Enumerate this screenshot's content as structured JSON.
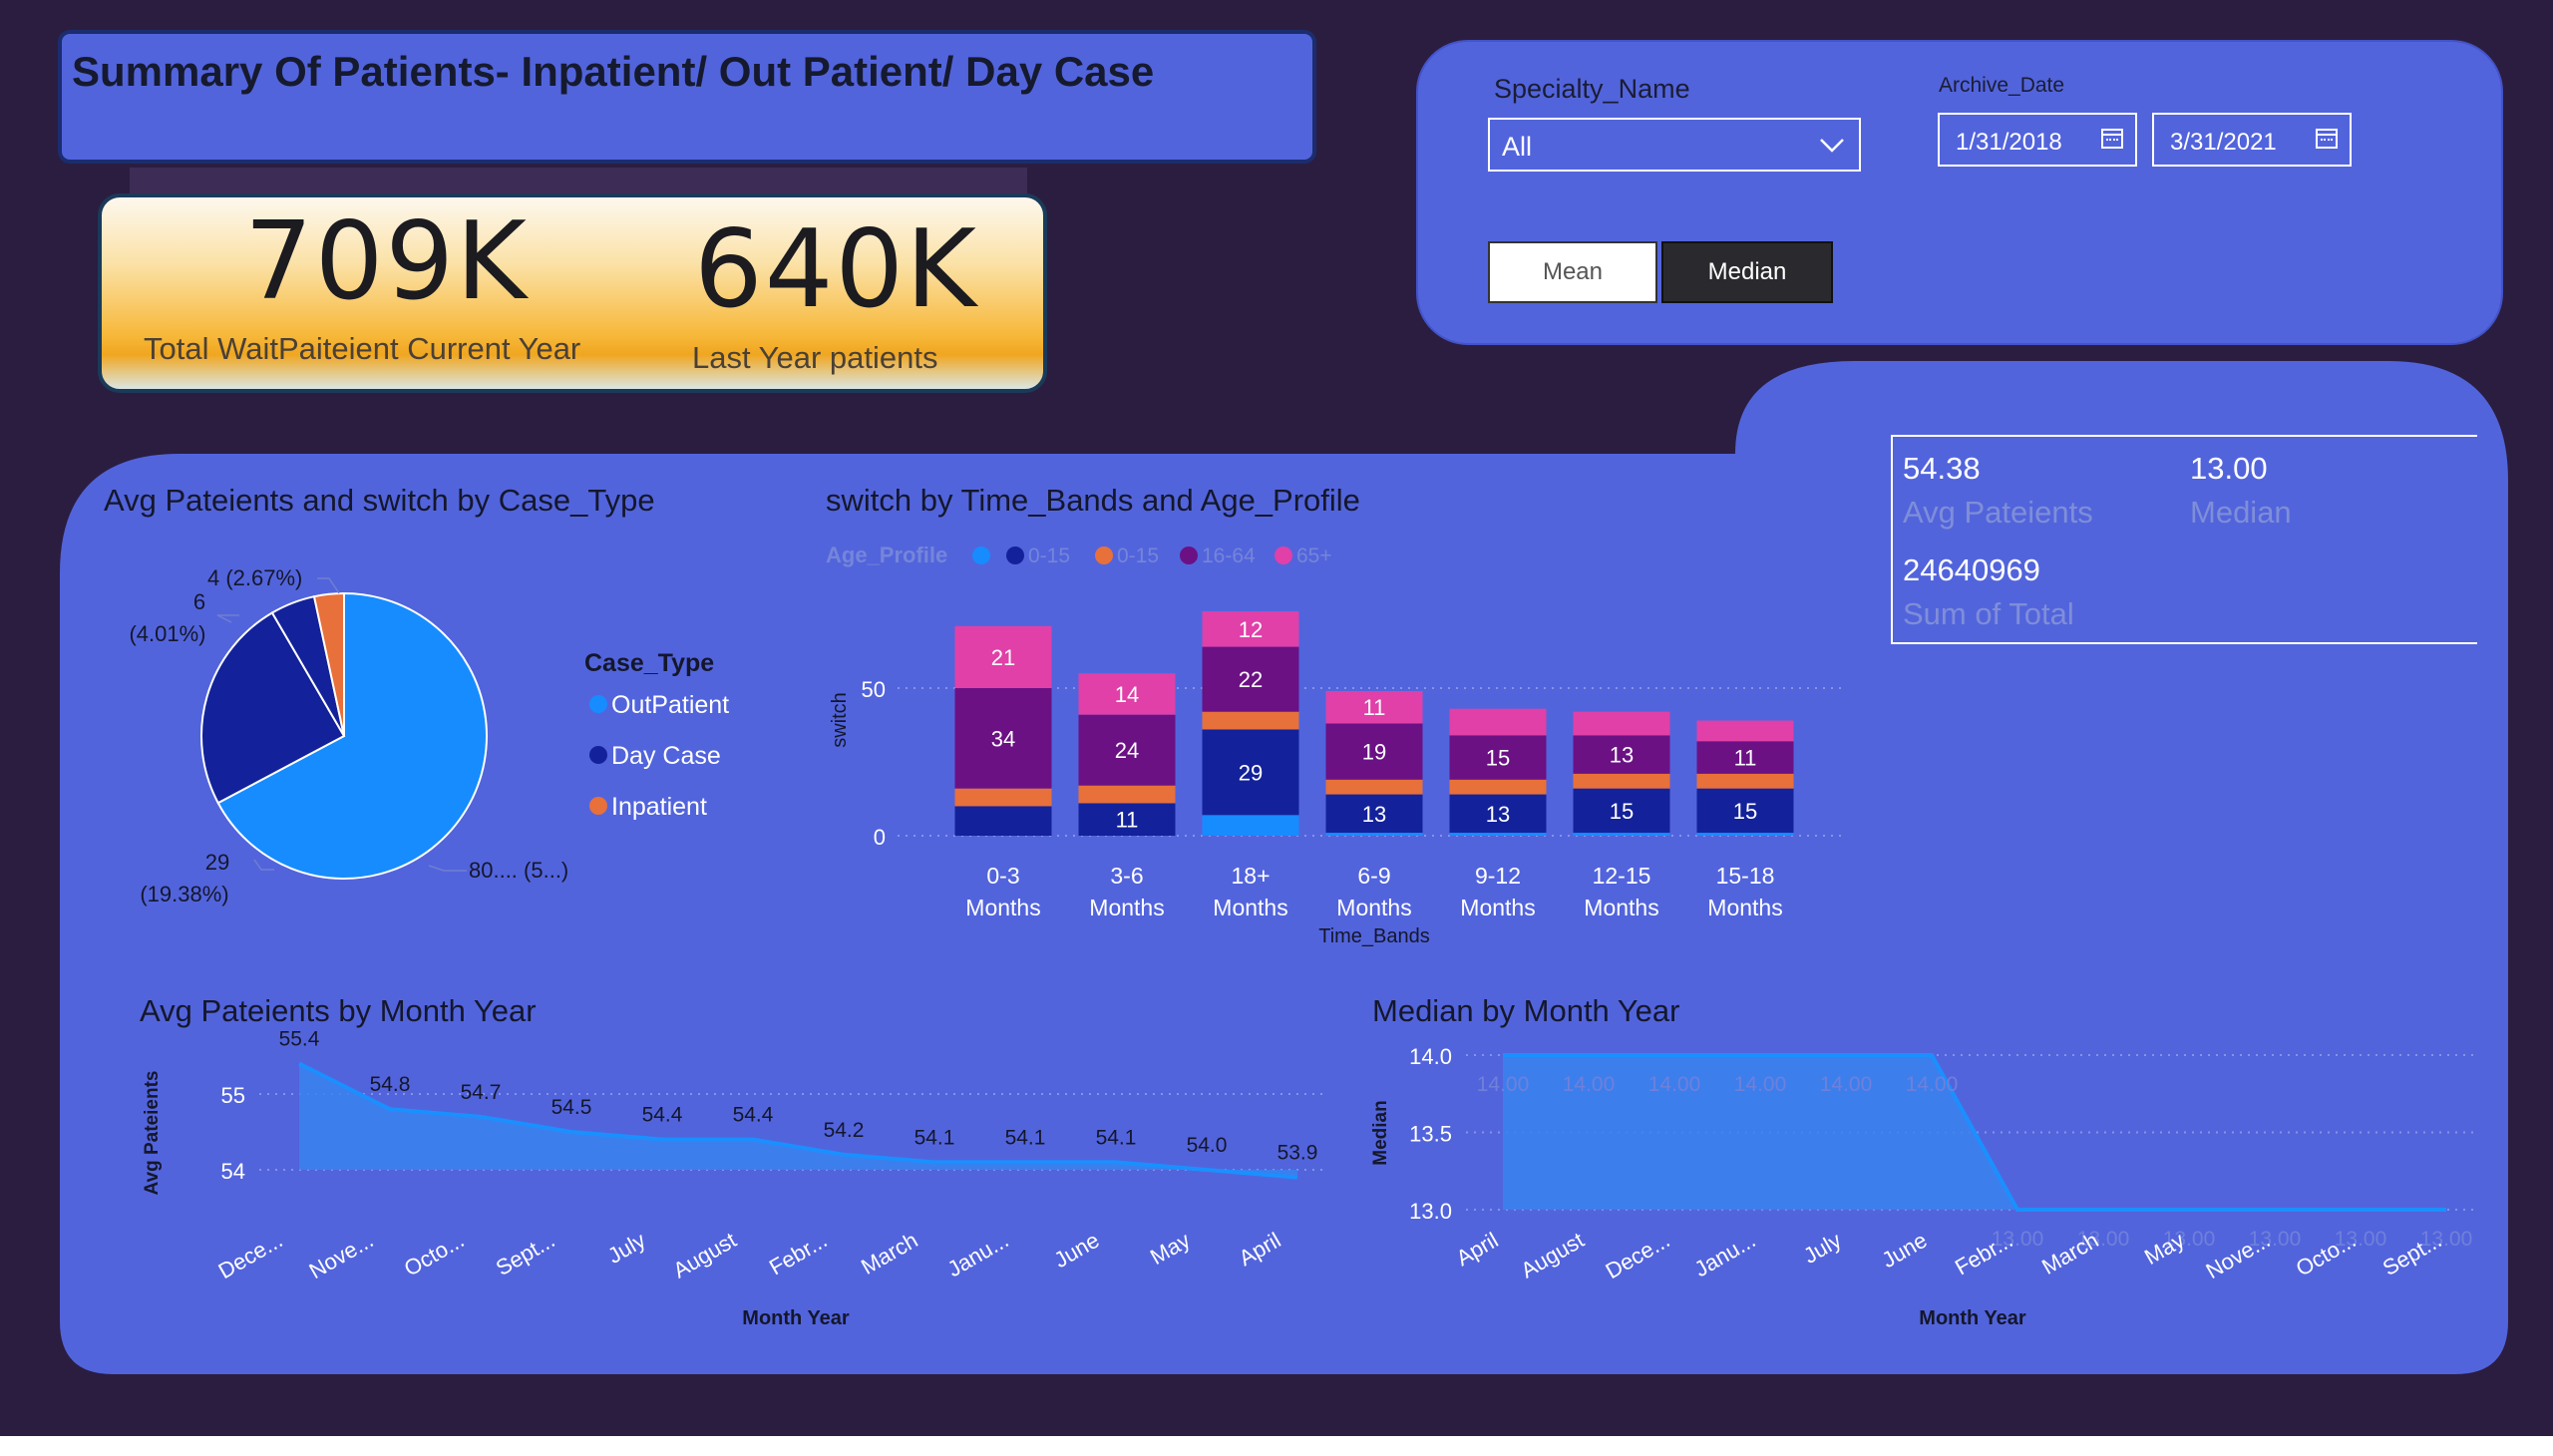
{
  "header": {
    "title": "Summary Of Patients- Inpatient/ Out Patient/ Day Case"
  },
  "kpis": [
    {
      "value": "709K",
      "label": "Total WaitPaiteient Current Year"
    },
    {
      "value": "640K",
      "label": "Last Year patients"
    }
  ],
  "filters": {
    "specialty_label": "Specialty_Name",
    "specialty_value": "All",
    "archive_label": "Archive_Date",
    "date_from": "1/31/2018",
    "date_to": "3/31/2021",
    "toggle": {
      "mean_label": "Mean",
      "median_label": "Median",
      "selected": "Median"
    }
  },
  "stats": {
    "avg_value": "54.38",
    "avg_label": "Avg Pateients",
    "median_value": "13.00",
    "median_label": "Median",
    "sum_value": "24640969",
    "sum_label": "Sum of Total"
  },
  "colors": {
    "background": "#2b1d40",
    "panel": "#5264dc",
    "outpatient": "#168cff",
    "day_case": "#13229a",
    "inpatient": "#e8703a",
    "age_16_64": "#6b1184",
    "age_65_plus": "#e040a8"
  },
  "chart_data": [
    {
      "type": "pie",
      "title": "Avg Pateients and switch by Case_Type",
      "legend_title": "Case_Type",
      "legend_position": "right",
      "series": [
        {
          "name": "OutPatient",
          "value": 80,
          "label": "80.... (5...)"
        },
        {
          "name": "Day Case",
          "value": 29,
          "label": "29",
          "percent": "(19.38%)"
        },
        {
          "name": "Day Case",
          "value": 6,
          "label": "6",
          "percent": "(4.01%)"
        },
        {
          "name": "Inpatient",
          "value": 4,
          "label": "4 (2.67%)"
        }
      ]
    },
    {
      "type": "bar",
      "stacked": true,
      "title": "switch by Time_Bands and Age_Profile",
      "legend_title": "Age_Profile",
      "legend_position": "top-left",
      "legend_items": [
        "",
        "0-15",
        "0-15",
        "16-64",
        "65+"
      ],
      "xlabel": "Time_Bands",
      "ylabel": "switch",
      "ylim": [
        0,
        70
      ],
      "yticks": [
        0,
        50
      ],
      "grid": true,
      "categories": [
        "0-3 Months",
        "3-6 Months",
        "18+ Months",
        "6-9 Months",
        "9-12 Months",
        "12-15 Months",
        "15-18 Months"
      ],
      "series": [
        {
          "name": "",
          "values": [
            0,
            0,
            7,
            1,
            1,
            1,
            1
          ]
        },
        {
          "name": "0-15",
          "values": [
            10,
            11,
            29,
            13,
            13,
            15,
            15
          ]
        },
        {
          "name": "0-15",
          "values": [
            6,
            6,
            6,
            5,
            5,
            5,
            5
          ]
        },
        {
          "name": "16-64",
          "values": [
            34,
            24,
            22,
            19,
            15,
            13,
            11
          ]
        },
        {
          "name": "65+",
          "values": [
            21,
            14,
            12,
            11,
            9,
            8,
            7
          ]
        }
      ],
      "data_labels": [
        [
          null,
          null,
          null,
          null,
          null,
          null,
          null
        ],
        [
          null,
          11,
          29,
          13,
          13,
          15,
          15
        ],
        [
          null,
          null,
          null,
          null,
          null,
          null,
          null
        ],
        [
          34,
          24,
          22,
          19,
          15,
          13,
          11
        ],
        [
          21,
          14,
          12,
          11,
          null,
          null,
          null
        ]
      ]
    },
    {
      "type": "area",
      "title": "Avg Pateients by Month Year",
      "xlabel": "Month Year",
      "ylabel": "Avg Pateients",
      "ylim": [
        53.5,
        55.5
      ],
      "yticks": [
        54,
        55
      ],
      "grid": true,
      "categories": [
        "Dece...",
        "Nove...",
        "Octo...",
        "Sept...",
        "July",
        "August",
        "Febr...",
        "March",
        "Janu...",
        "June",
        "May",
        "April"
      ],
      "values": [
        55.4,
        54.8,
        54.7,
        54.5,
        54.4,
        54.4,
        54.2,
        54.1,
        54.1,
        54.1,
        54.0,
        53.9
      ],
      "value_labels": [
        "55.4",
        "54.8",
        "54.7",
        "54.5",
        "54.4",
        "54.4",
        "54.2",
        "54.1",
        "54.1",
        "54.1",
        "54.0",
        "53.9"
      ]
    },
    {
      "type": "area",
      "title": "Median by Month Year",
      "xlabel": "Month Year",
      "ylabel": "Median",
      "ylim": [
        13.0,
        14.0
      ],
      "yticks": [
        13.0,
        13.5,
        14.0
      ],
      "ytick_labels": [
        "13.0",
        "13.5",
        "14.0"
      ],
      "grid": true,
      "categories": [
        "April",
        "August",
        "Dece...",
        "Janu...",
        "July",
        "June",
        "Febr...",
        "March",
        "May",
        "Nove...",
        "Octo...",
        "Sept..."
      ],
      "values": [
        14.0,
        14.0,
        14.0,
        14.0,
        14.0,
        14.0,
        13.0,
        13.0,
        13.0,
        13.0,
        13.0,
        13.0
      ],
      "value_labels": [
        "14.00",
        "14.00",
        "14.00",
        "14.00",
        "14.00",
        "14.00",
        "13.00",
        "13.00",
        "13.00",
        "13.00",
        "13.00",
        "13.00"
      ]
    }
  ]
}
